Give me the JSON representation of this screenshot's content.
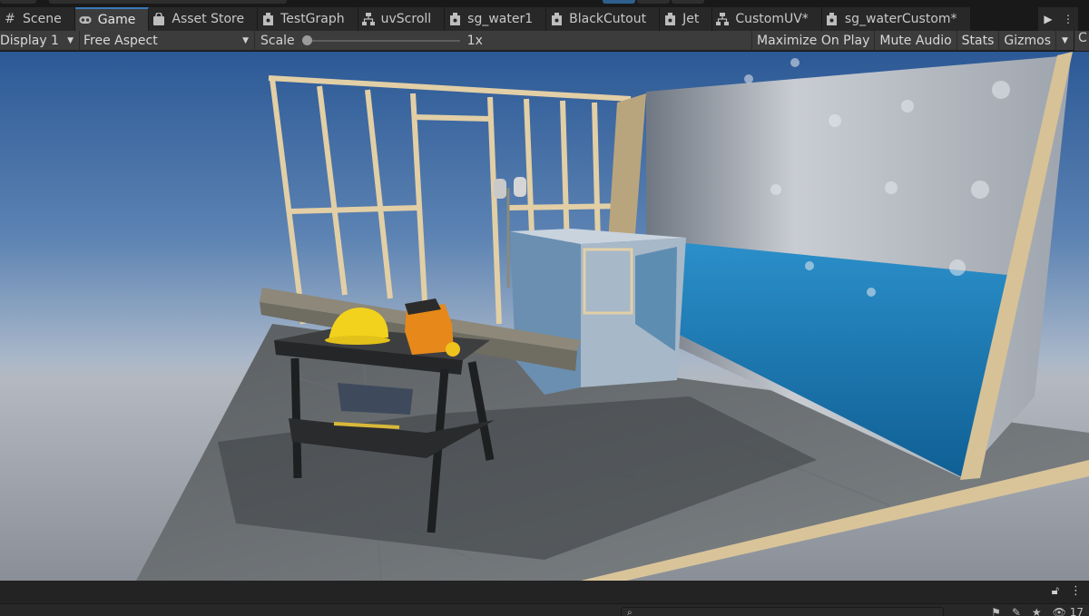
{
  "tabs": [
    {
      "label": "Scene",
      "icon": "hash-icon",
      "active": false
    },
    {
      "label": "Game",
      "icon": "gamepad-icon",
      "active": true
    },
    {
      "label": "Asset Store",
      "icon": "shopping-bag-icon",
      "active": false
    },
    {
      "label": "TestGraph",
      "icon": "shader-graph-icon",
      "active": false
    },
    {
      "label": "uvScroll",
      "icon": "node-graph-icon",
      "active": false
    },
    {
      "label": "sg_water1",
      "icon": "shader-graph-icon",
      "active": false
    },
    {
      "label": "BlackCutout",
      "icon": "shader-graph-icon",
      "active": false
    },
    {
      "label": "Jet",
      "icon": "shader-graph-icon",
      "active": false
    },
    {
      "label": "CustomUV*",
      "icon": "node-graph-icon",
      "active": false
    },
    {
      "label": "sg_waterCustom*",
      "icon": "shader-graph-icon",
      "active": false
    }
  ],
  "toolbar": {
    "display": "Display 1",
    "aspect": "Free Aspect",
    "scale_label": "Scale",
    "scale_value": "1x",
    "scale_fraction": 0.0,
    "maximize": "Maximize On Play",
    "mute": "Mute Audio",
    "stats": "Stats",
    "gizmos": "Gizmos"
  },
  "side_panel_label": "C",
  "search": {
    "placeholder": "⌕"
  },
  "bottom": {
    "visibility_count": "17"
  },
  "colors": {
    "accent": "#3a79bb",
    "tab_active_bg": "#3c3c3c",
    "editor_bg": "#191919"
  }
}
